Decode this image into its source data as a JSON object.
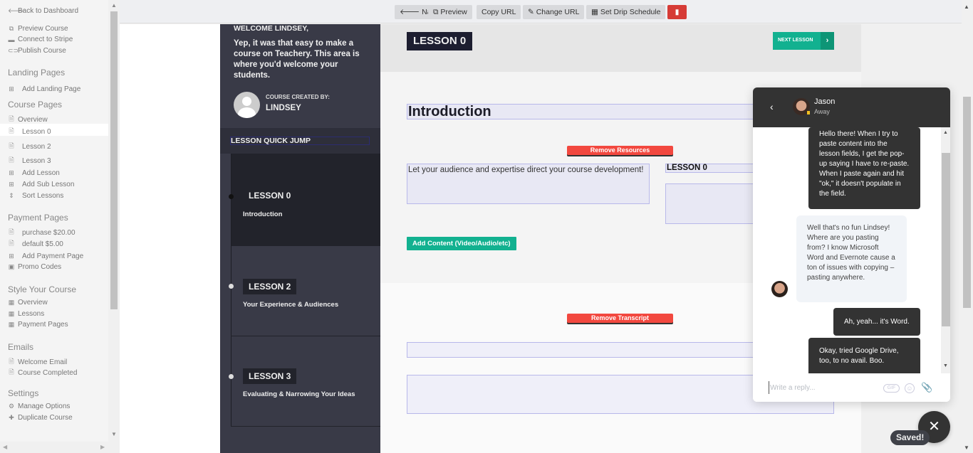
{
  "sidebar": {
    "back": {
      "icon": "arrow-left-icon",
      "label": "Back to Dashboard"
    },
    "actions": [
      {
        "icon": "external-link-icon",
        "label": "Preview Course"
      },
      {
        "icon": "stripe-icon",
        "label": "Connect to Stripe"
      },
      {
        "icon": "toggle-icon",
        "label": "Publish Course"
      }
    ],
    "landing_pages": {
      "heading": "Landing Pages",
      "items": [
        {
          "icon": "plus-square-icon",
          "label": "Add Landing Page"
        }
      ]
    },
    "course_pages": {
      "heading": "Course Pages",
      "items": [
        {
          "icon": "file-icon",
          "label": "Overview"
        },
        {
          "icon": "file-icon",
          "label": "Lesson 0",
          "active": true
        },
        {
          "icon": "file-icon",
          "label": "Lesson 2"
        },
        {
          "icon": "file-icon",
          "label": "Lesson 3"
        },
        {
          "icon": "plus-square-icon",
          "label": "Add Lesson"
        },
        {
          "icon": "plus-square-icon",
          "label": "Add Sub Lesson"
        },
        {
          "icon": "sort-icon",
          "label": "Sort Lessons"
        }
      ]
    },
    "payment_pages": {
      "heading": "Payment Pages",
      "items": [
        {
          "icon": "file-icon",
          "label": "purchase $20.00"
        },
        {
          "icon": "file-icon",
          "label": "default $5.00"
        },
        {
          "icon": "plus-square-icon",
          "label": "Add Payment Page"
        },
        {
          "icon": "ticket-icon",
          "label": "Promo Codes"
        }
      ]
    },
    "style": {
      "heading": "Style Your Course",
      "items": [
        {
          "icon": "grid-icon",
          "label": "Overview"
        },
        {
          "icon": "grid-icon",
          "label": "Lessons"
        },
        {
          "icon": "grid-icon",
          "label": "Payment Pages"
        }
      ]
    },
    "emails": {
      "heading": "Emails",
      "items": [
        {
          "icon": "file-icon",
          "label": "Welcome Email"
        },
        {
          "icon": "file-icon",
          "label": "Course Completed"
        }
      ]
    },
    "settings": {
      "heading": "Settings",
      "items": [
        {
          "icon": "gears-icon",
          "label": "Manage Options"
        },
        {
          "icon": "plus-icon",
          "label": "Duplicate Course"
        }
      ]
    }
  },
  "toolbar": {
    "nav": "Nav",
    "preview": "Preview",
    "copy_url": "Copy URL",
    "change_url": "Change URL",
    "drip": "Set Drip Schedule",
    "delete_icon": "trash-icon"
  },
  "lesson_panel": {
    "welcome_title": "WELCOME LINDSEY,",
    "welcome_body": "Yep, it was that easy to make a course on Teachery. This area is where you'd welcome your students.",
    "created_by_label": "COURSE CREATED BY:",
    "creator": "LINDSEY",
    "quick_jump": "LESSON QUICK JUMP",
    "lessons": [
      {
        "badge": "LESSON 0",
        "title": "Introduction",
        "active": true
      },
      {
        "badge": "LESSON 2",
        "title": "Your Experience & Audiences"
      },
      {
        "badge": "LESSON 3",
        "title": "Evaluating & Narrowing Your Ideas"
      }
    ]
  },
  "content": {
    "lesson_badge": "LESSON 0",
    "next_lesson": "NEXT LESSON",
    "intro_title": "Introduction",
    "remove_resources": "Remove Resources",
    "description": "Let your audience and expertise direct your course development!",
    "resource_title": "LESSON 0",
    "add_content": "Add Content (Video/Audio/etc)",
    "remove_transcript": "Remove Transcript"
  },
  "chat": {
    "agent_name": "Jason",
    "agent_status": "Away",
    "status_color": "#f4c020",
    "messages": [
      {
        "from": "user",
        "text": "Hello there! When I try to paste content into the lesson fields, I get the pop-up saying I have to re-paste. When I paste again and hit \"ok,\" it doesn't populate in the field."
      },
      {
        "from": "agent",
        "text": "Well that's no fun Lindsey! Where are you pasting from? I know Microsoft Word and Evernote cause a ton of issues with copying – pasting anywhere."
      },
      {
        "from": "user",
        "text": "Ah, yeah... it's Word."
      },
      {
        "from": "user",
        "text": "Okay, tried Google Drive, too, to no avail. Boo."
      }
    ],
    "reply_placeholder": "Write a reply...",
    "gif_label": "GIF"
  },
  "saved_badge": "Saved!",
  "colors": {
    "accent_green": "#12b190",
    "danger_red": "#f2483f",
    "panel_dark": "#393a47",
    "chat_dark": "#333333"
  }
}
